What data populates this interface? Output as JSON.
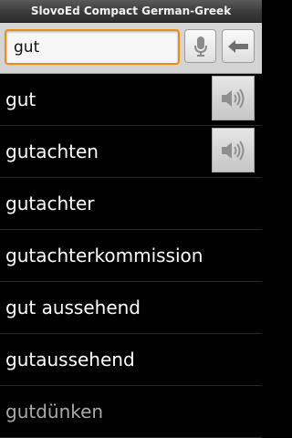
{
  "app": {
    "title": "SlovoEd Compact German-Greek"
  },
  "search": {
    "value": "gut"
  },
  "icons": {
    "mic": "microphone-icon",
    "backspace": "backspace-arrow-icon",
    "speaker": "speaker-icon"
  },
  "results": [
    {
      "word": "gut",
      "has_audio": true
    },
    {
      "word": "gutachten",
      "has_audio": true
    },
    {
      "word": "gutachter",
      "has_audio": false
    },
    {
      "word": "gutachterkommission",
      "has_audio": false
    },
    {
      "word": "gut aussehend",
      "has_audio": false
    },
    {
      "word": "gutaussehend",
      "has_audio": false
    },
    {
      "word": "gutdünken",
      "has_audio": false
    }
  ],
  "colors": {
    "focus_border": "#f08c0c",
    "list_background": "#000000",
    "toolbar_background": "#d4d4d4"
  }
}
